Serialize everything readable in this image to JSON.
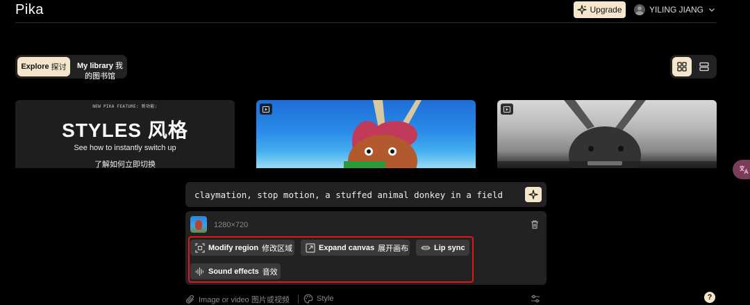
{
  "header": {
    "logo": "Pika",
    "upgrade_label": "Upgrade",
    "user_name": "YILING JIANG"
  },
  "tabs": {
    "explore_label": "Explore",
    "explore_cn": "探讨",
    "library_label": "My library",
    "library_cn_1": "我",
    "library_cn_2": "的图书馆"
  },
  "feature_card": {
    "eyebrow": "NEW PIKA FEATURE: 新功能:",
    "title": "STYLES 风格",
    "subtitle_en": "See how to instantly switch up",
    "subtitle_cn": "了解如何立即切换"
  },
  "prompt": {
    "text": "claymation, stop motion, a stuffed animal donkey in a field"
  },
  "tools": {
    "resolution": "1280×720",
    "modify_region": "Modify region",
    "modify_region_cn": "修改区域",
    "expand_canvas": "Expand canvas",
    "expand_canvas_cn": "展开画布",
    "lip_sync": "Lip sync",
    "sound_effects": "Sound effects",
    "sound_effects_cn": "音效"
  },
  "bottom": {
    "attach_label": "Image or video 图片或视频",
    "style_label": "Style",
    "help_label": "?"
  },
  "colors": {
    "accent": "#f5e6cc",
    "panel": "#222222",
    "highlight": "#e01818"
  }
}
